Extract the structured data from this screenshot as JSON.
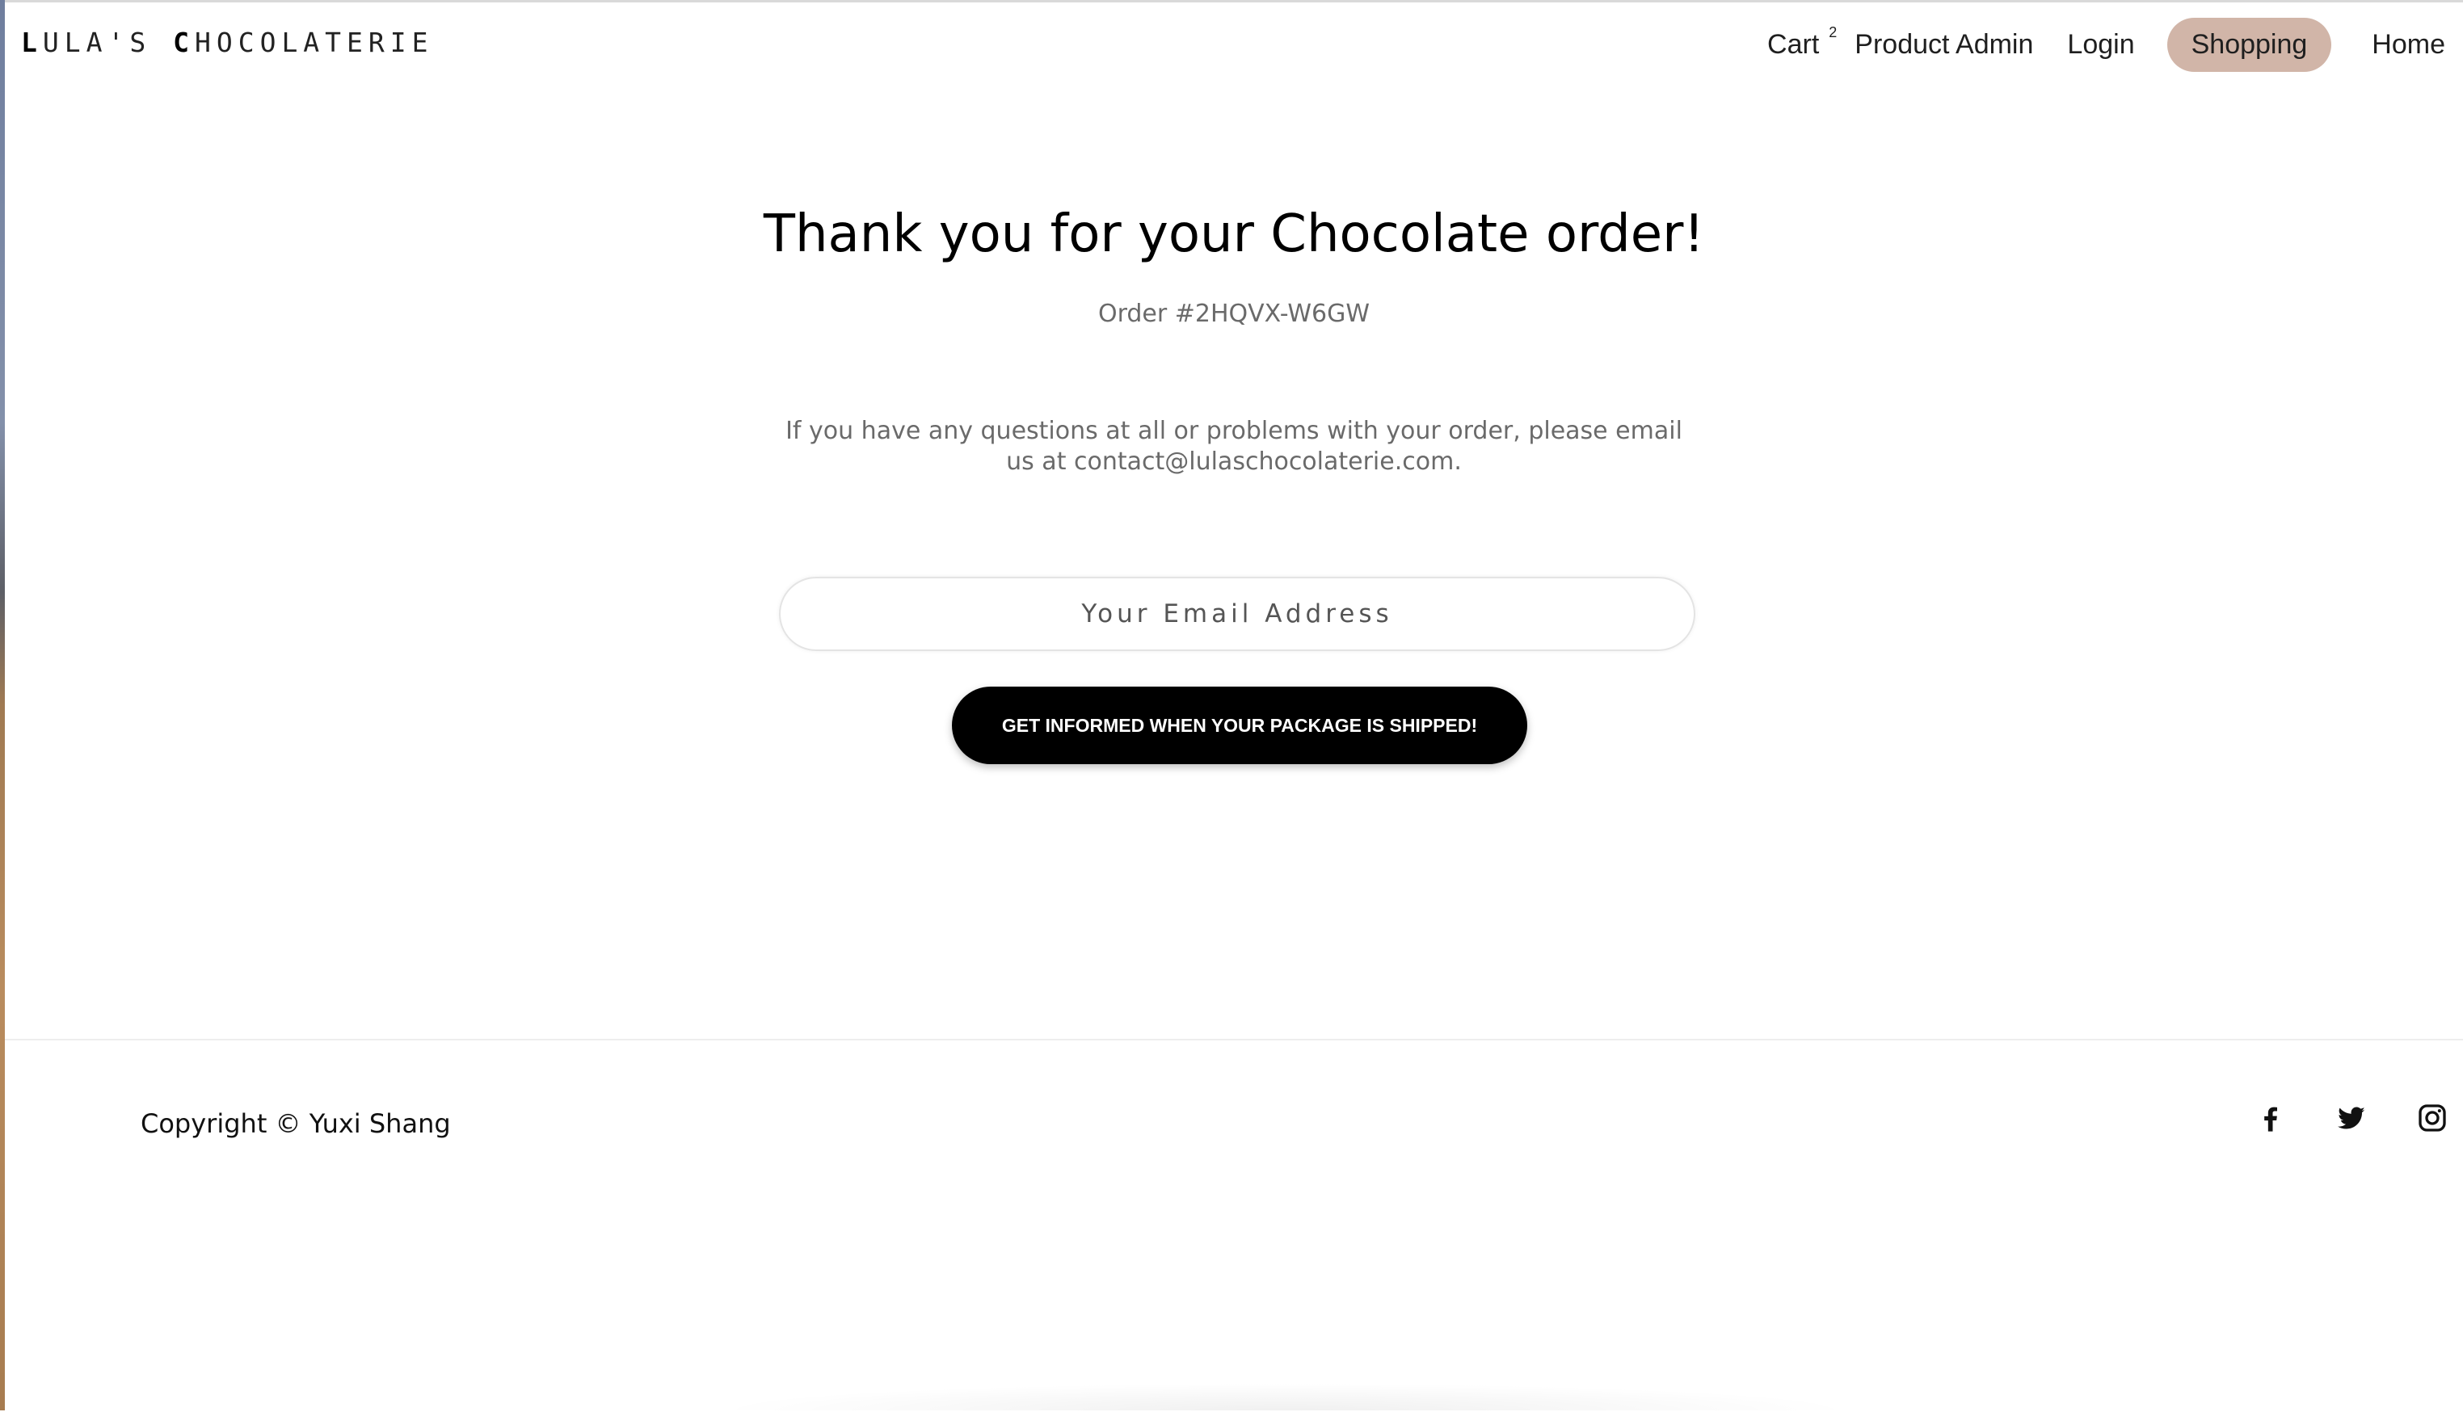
{
  "brand": {
    "initial_1": "L",
    "rest_1": "ULA'S ",
    "initial_2": "C",
    "rest_2": "HOCOLATERIE"
  },
  "nav": {
    "cart_label": "Cart",
    "cart_count": "2",
    "product_admin": "Product Admin",
    "login": "Login",
    "shopping": "Shopping",
    "home": "Home"
  },
  "main": {
    "title": "Thank you for your Chocolate order!",
    "order_number": "Order #2HQVX-W6GW",
    "message": "If you have any questions at all or problems with your order, please email us at contact@lulaschocolaterie.com.",
    "email_placeholder": "Your Email Address",
    "email_value": "",
    "notify_button": "GET INFORMED WHEN YOUR PACKAGE IS SHIPPED!"
  },
  "footer": {
    "copyright": "Copyright © Yuxi Shang",
    "social_icons": [
      "facebook-icon",
      "twitter-icon",
      "instagram-icon"
    ]
  },
  "colors": {
    "accent_pill": "#d1b5a8",
    "button_bg": "#000000",
    "button_text": "#ffffff",
    "muted_text": "#6a6a6a"
  }
}
